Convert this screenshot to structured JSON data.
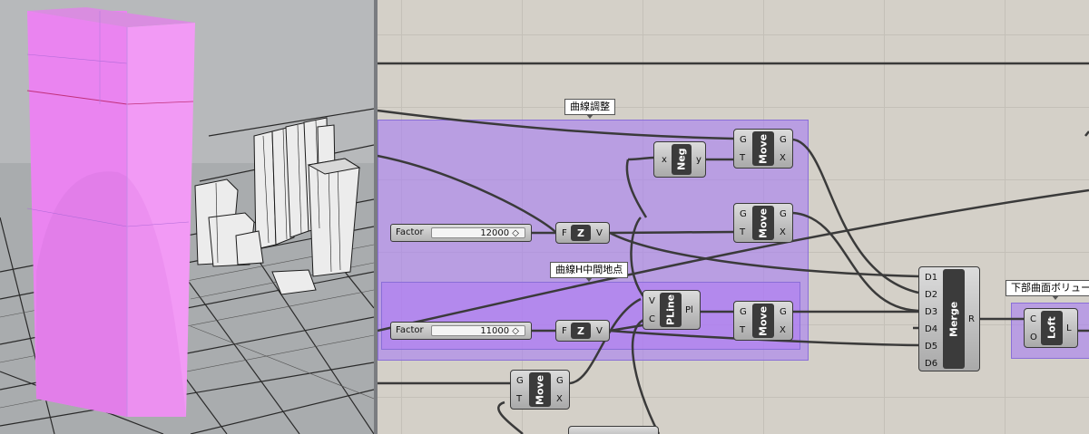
{
  "viewport": {
    "name": "rhino-perspective-viewport",
    "tower_color": "#ee88f2",
    "background_color": "#b7b9bb"
  },
  "groups": {
    "curve_adjust": "曲線調整",
    "curve_h_midpoint": "曲線H中間地点",
    "lower_surface_volume": "下部曲面ボリューム"
  },
  "sliders": {
    "factor_1": {
      "label": "Factor",
      "value": "12000 ◇"
    },
    "factor_2": {
      "label": "Factor",
      "value": "11000 ◇"
    }
  },
  "components": {
    "neg": {
      "name": "Neg",
      "inputs": [
        "x"
      ],
      "outputs": [
        "y"
      ]
    },
    "move": {
      "name": "Move",
      "inputs": [
        "G",
        "T"
      ],
      "outputs": [
        "G",
        "X"
      ]
    },
    "unit_z": {
      "name": "Z",
      "inputs": [
        "F"
      ],
      "outputs": [
        "V"
      ]
    },
    "pline": {
      "name": "PLine",
      "inputs": [
        "V",
        "C"
      ],
      "outputs": [
        "Pl"
      ]
    },
    "merge": {
      "name": "Merge",
      "inputs": [
        "D1",
        "D2",
        "D3",
        "D4",
        "D5",
        "D6"
      ],
      "outputs": [
        "R"
      ]
    },
    "loft": {
      "name": "Loft",
      "inputs": [
        "C",
        "O"
      ],
      "outputs": [
        "L"
      ]
    }
  },
  "colors": {
    "group_fill": "#b49ae8",
    "wire": "#3a3a3a",
    "canvas": "#d4d0c8"
  }
}
